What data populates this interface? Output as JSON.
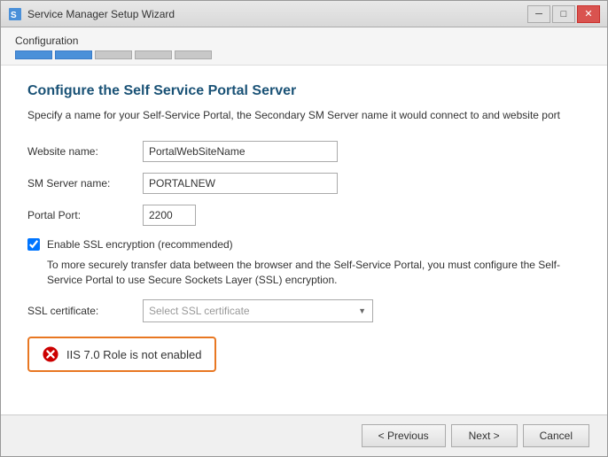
{
  "window": {
    "title": "Service Manager Setup Wizard",
    "close_label": "✕",
    "min_label": "─",
    "max_label": "□"
  },
  "progress": {
    "label": "Configuration",
    "segments": [
      {
        "filled": true
      },
      {
        "filled": true
      },
      {
        "filled": false
      },
      {
        "filled": false
      },
      {
        "filled": false
      }
    ]
  },
  "section": {
    "title": "Configure the Self Service Portal Server",
    "description": "Specify a name for your Self-Service Portal, the Secondary SM Server name it would connect to and website port"
  },
  "form": {
    "website_label": "Website name:",
    "website_value": "PortalWebSiteName",
    "sm_server_label": "SM Server name:",
    "sm_server_value": "PORTALNEW",
    "portal_port_label": "Portal Port:",
    "portal_port_value": "2200",
    "ssl_checkbox_label": "Enable SSL encryption (recommended)",
    "ssl_note": "To more securely transfer data between the browser and the Self-Service Portal, you must configure the Self-Service Portal to use Secure Sockets Layer (SSL) encryption.",
    "ssl_cert_label": "SSL certificate:",
    "ssl_cert_placeholder": "Select SSL certificate"
  },
  "error": {
    "text": "IIS 7.0 Role is not enabled"
  },
  "footer": {
    "previous_label": "< Previous",
    "next_label": "Next >",
    "cancel_label": "Cancel"
  }
}
